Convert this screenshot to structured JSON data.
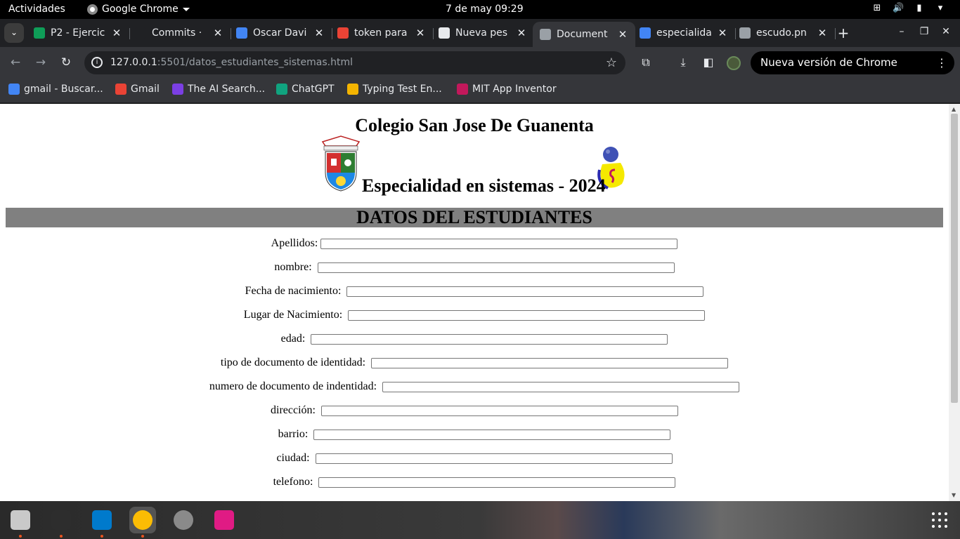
{
  "topbar": {
    "activities": "Actividades",
    "app_name": "Google Chrome",
    "clock": "7 de may  09:29"
  },
  "tabs": [
    {
      "title": "P2 - Ejercic",
      "favicon_color": "#0f9d58",
      "icon": "classroom-icon"
    },
    {
      "title": "Commits · ",
      "favicon_color": "#202124",
      "icon": "github-icon"
    },
    {
      "title": "Oscar Davi",
      "favicon_color": "#4285f4",
      "icon": "docs-icon"
    },
    {
      "title": "token para",
      "favicon_color": "#ea4335",
      "icon": "gmail-icon"
    },
    {
      "title": "Nueva pes",
      "favicon_color": "#e8eaed",
      "icon": "chrome-icon"
    },
    {
      "title": "Document",
      "favicon_color": "#9aa0a6",
      "icon": "globe-icon",
      "active": true
    },
    {
      "title": "especialida",
      "favicon_color": "#4285f4",
      "icon": "google-icon"
    },
    {
      "title": "escudo.pn",
      "favicon_color": "#9aa0a6",
      "icon": "globe-icon"
    }
  ],
  "omnibox": {
    "host": "127.0.0.1",
    "path": ":5501/datos_estudiantes_sistemas.html"
  },
  "update_notice": "Nueva versión de Chrome disponible",
  "bookmarks": [
    {
      "label": "gmail - Buscar...",
      "color": "#4285f4"
    },
    {
      "label": "Gmail",
      "color": "#ea4335"
    },
    {
      "label": "The AI Search...",
      "color": "#7b3fe4"
    },
    {
      "label": "ChatGPT",
      "color": "#10a37f"
    },
    {
      "label": "Typing Test En...",
      "color": "#f4b400"
    },
    {
      "label": "MIT App Inventor",
      "color": "#c2185b"
    }
  ],
  "page": {
    "school": "Colegio San Jose De Guanenta",
    "specialty": "Especialidad en sistemas - 2024",
    "section_title": "DATOS DEL ESTUDIANTES",
    "banner_color": "#808080",
    "fields": [
      {
        "label": "Apellidos:",
        "value": ""
      },
      {
        "label": "nombre: ",
        "value": ""
      },
      {
        "label": "Fecha de nacimiento: ",
        "value": ""
      },
      {
        "label": "Lugar de Nacimiento: ",
        "value": ""
      },
      {
        "label": "edad: ",
        "value": ""
      },
      {
        "label": "tipo de documento de identidad: ",
        "value": ""
      },
      {
        "label": "numero de documento de indentidad: ",
        "value": ""
      },
      {
        "label": "dirección: ",
        "value": ""
      },
      {
        "label": "barrio: ",
        "value": ""
      },
      {
        "label": "ciudad: ",
        "value": ""
      },
      {
        "label": "telefono: ",
        "value": ""
      }
    ]
  },
  "dock": [
    {
      "name": "files-app",
      "color": "#c9c9c9"
    },
    {
      "name": "terminal-app",
      "color": "#2d2d2d"
    },
    {
      "name": "vscode-app",
      "color": "#007acc"
    },
    {
      "name": "chrome-app",
      "color": "#fbbc04"
    },
    {
      "name": "settings-app",
      "color": "#8a8a8a"
    },
    {
      "name": "screenshot-app",
      "color": "#e01b84"
    }
  ]
}
